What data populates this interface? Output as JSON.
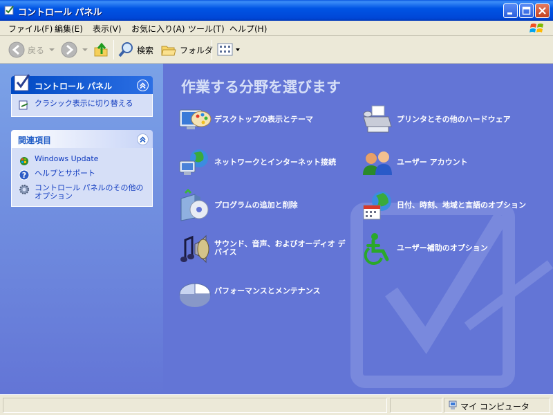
{
  "window": {
    "title": "コントロール パネル"
  },
  "menu": [
    {
      "label": "ファイル(F)"
    },
    {
      "label": "編集(E)"
    },
    {
      "label": "表示(V)"
    },
    {
      "label": "お気に入り(A)"
    },
    {
      "label": "ツール(T)"
    },
    {
      "label": "ヘルプ(H)"
    }
  ],
  "toolbar": {
    "back_label": "戻る",
    "search_label": "検索",
    "folders_label": "フォルダ"
  },
  "left": {
    "panel_box": {
      "title": "コントロール パネル",
      "link": "クラシック表示に切り替える"
    },
    "related_box": {
      "title": "関連項目",
      "links": [
        {
          "label": "Windows Update",
          "icon": "windows-update-icon"
        },
        {
          "label": "ヘルプとサポート",
          "icon": "help-icon"
        },
        {
          "label": "コントロール パネルのその他のオプション",
          "icon": "gear-icon"
        }
      ]
    }
  },
  "main": {
    "title": "作業する分野を選びます",
    "categories": [
      {
        "label": "デスクトップの表示とテーマ",
        "icon": "desktop-theme-icon"
      },
      {
        "label": "プリンタとその他のハードウェア",
        "icon": "printer-icon"
      },
      {
        "label": "ネットワークとインターネット接続",
        "icon": "network-icon"
      },
      {
        "label": "ユーザー アカウント",
        "icon": "user-accounts-icon"
      },
      {
        "label": "プログラムの追加と削除",
        "icon": "add-remove-programs-icon"
      },
      {
        "label": "日付、時刻、地域と言語のオプション",
        "icon": "date-time-region-icon"
      },
      {
        "label": "サウンド、音声、およびオーディオ デバイス",
        "icon": "sound-icon"
      },
      {
        "label": "ユーザー補助のオプション",
        "icon": "accessibility-icon"
      },
      {
        "label": "パフォーマンスとメンテナンス",
        "icon": "performance-icon"
      }
    ]
  },
  "status": {
    "location": "マイ コンピュータ"
  },
  "colors": {
    "titlebar": "#0054E3",
    "left_pane": "#7BA2E7",
    "main_pane": "#6375D6",
    "link": "#0F3ABF"
  }
}
